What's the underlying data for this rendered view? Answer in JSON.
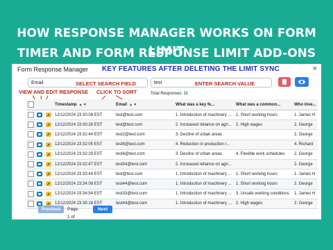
{
  "banner": {
    "line1": "HOW RESPONSE MANAGER WORKS ON FORM LIMIT",
    "line2": "TIMER AND FORM RESPONSE LIMIT ADD-ONS"
  },
  "window": {
    "title": "Form Response Manager",
    "close_label": "×",
    "headline": "KEY FEATURES AFTER DELETING THE LIMIT SYNC"
  },
  "toolbar": {
    "select_value": "Email",
    "search_value": "test",
    "delete_icon": "trash-icon",
    "view_icon": "eye-icon",
    "total_label": "Total Responses:",
    "total_value": "11"
  },
  "annotations": {
    "select_search_field": "SELECT SEARCH FIELD",
    "enter_search_value": "ENTER SEARCH VALUE",
    "view_edit_response": "VIEW AND EDIT RESPONSE",
    "click_to_sort": "CLICK TO SORT"
  },
  "table": {
    "columns": [
      "",
      "",
      "",
      "Timestamp",
      "Email",
      "What was a key fe...",
      "What was a common...",
      "Who inve..."
    ],
    "sort_glyph": "▲ ▼",
    "rows": [
      [
        "12/12/2024 23:30:08 EST",
        "test@test.com",
        "1. Introduction of machinery ...",
        "1. Short working hours",
        "1. James H"
      ],
      [
        "12/12/2024 23:30:28 EST",
        "test@test.com",
        "2. Increased reliance on agri...",
        "2. High wages",
        "2. George"
      ],
      [
        "12/12/2024 23:31:44 EST",
        "test2@test.com",
        "3. Decline of urban areas",
        "",
        "2. George"
      ],
      [
        "12/12/2024 23:32:05 EST",
        "test6@test.com",
        "4. Reduction in production r...",
        "",
        "4. Richard"
      ],
      [
        "12/12/2024 23:32:29 EST",
        "test6@test.com",
        "3. Decline of urban areas",
        "4. Flexible work schedules",
        "2. George"
      ],
      [
        "12/12/2024 23:32:47 EST",
        "test54@test.com",
        "2. Increased reliance on agri...",
        "",
        "2. George"
      ],
      [
        "12/12/2024 23:33:44 EST",
        "test@test.com",
        "1. Introduction of machinery ...",
        "1. Short working hours",
        "1. James H"
      ],
      [
        "12/12/2024 23:34:08 EST",
        "test44@test.com",
        "1. Introduction of machinery ...",
        "1. Short working hours",
        "2. George"
      ],
      [
        "12/12/2024 23:34:54 EST",
        "test33@test.com",
        "1. Introduction of machinery ...",
        "3. Unsafe working conditions",
        "1. James H"
      ],
      [
        "12/12/2024 23:35:18 EST",
        "test44@test.com",
        "1. Introduction of machinery ...",
        "2. High wages",
        "2. George"
      ]
    ]
  },
  "pagination": {
    "prev_label": "Previous",
    "page_text": "Page 1 of 2",
    "next_label": "Next"
  }
}
